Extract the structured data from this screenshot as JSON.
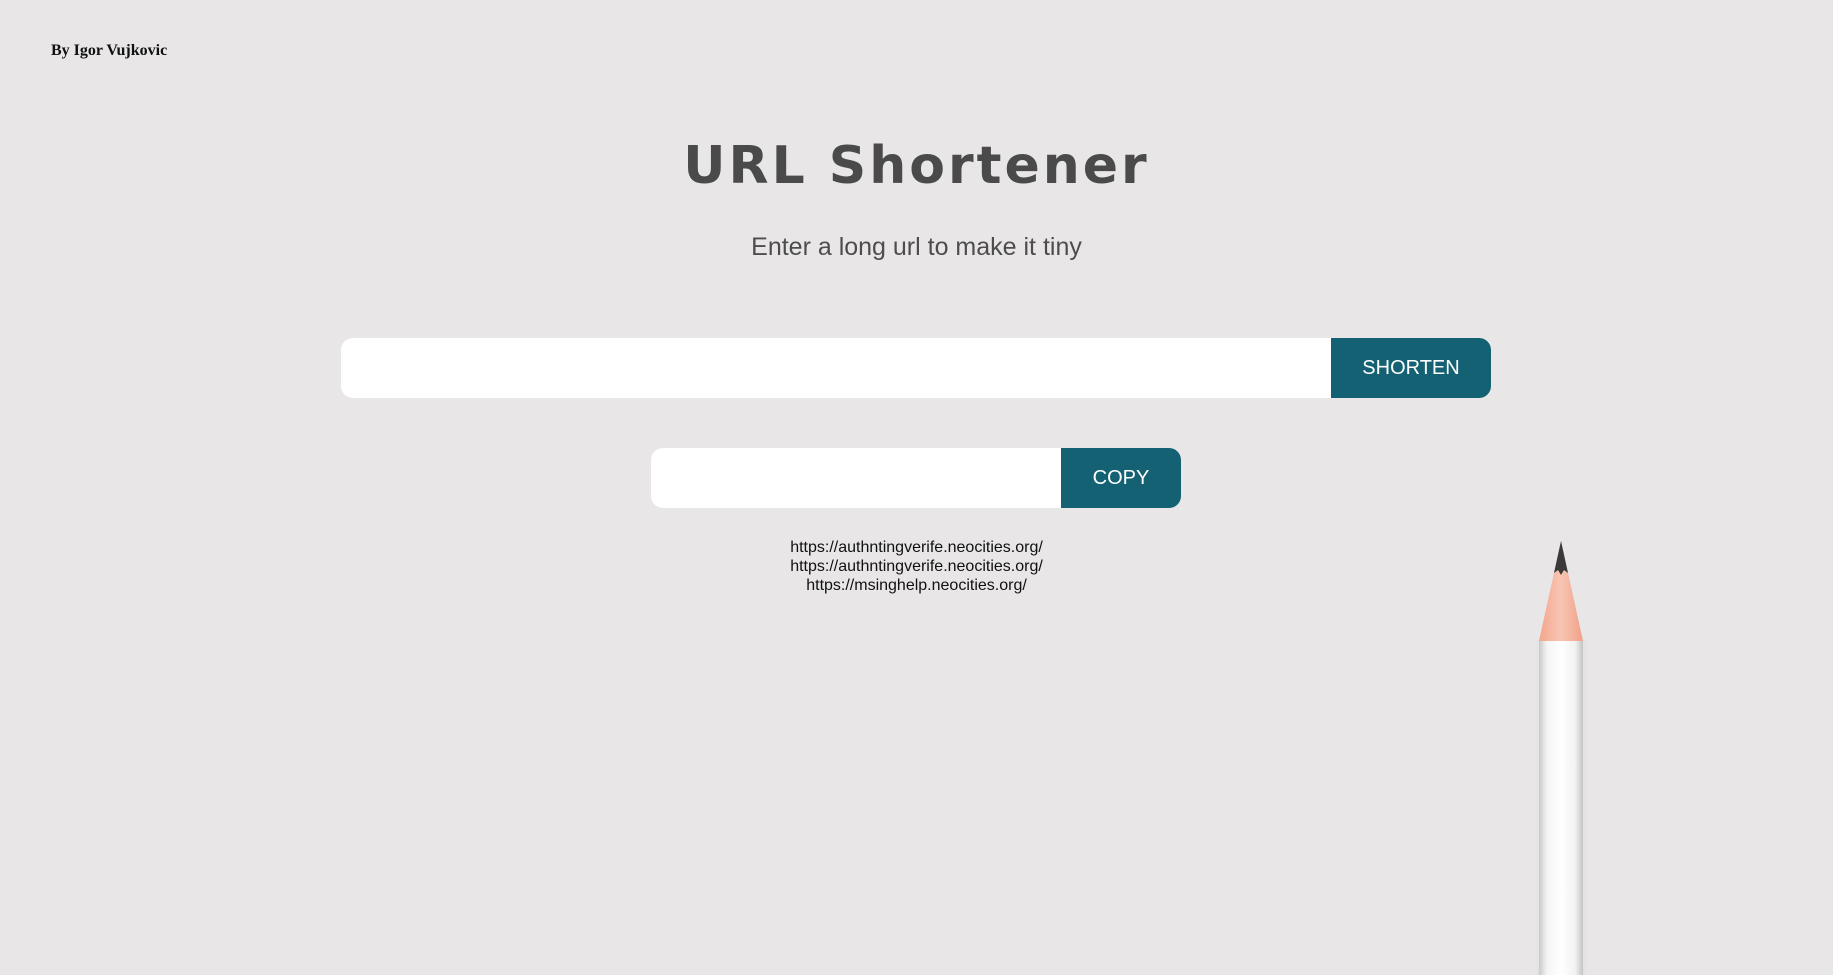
{
  "author": "By Igor Vujkovic",
  "title": "URL Shortener",
  "subtitle": "Enter a long url to make it tiny",
  "shorten": {
    "input_value": "",
    "button_label": "SHORTEN"
  },
  "copy": {
    "input_value": "",
    "button_label": "COPY"
  },
  "links": [
    "https://authntingverife.neocities.org/",
    "https://authntingverife.neocities.org/",
    "https://msinghelp.neocities.org/"
  ],
  "colors": {
    "background": "#e8e6e7",
    "accent": "#136172",
    "title_text": "#4a4a4a"
  },
  "icons": {
    "decoration": "pencil-icon"
  }
}
